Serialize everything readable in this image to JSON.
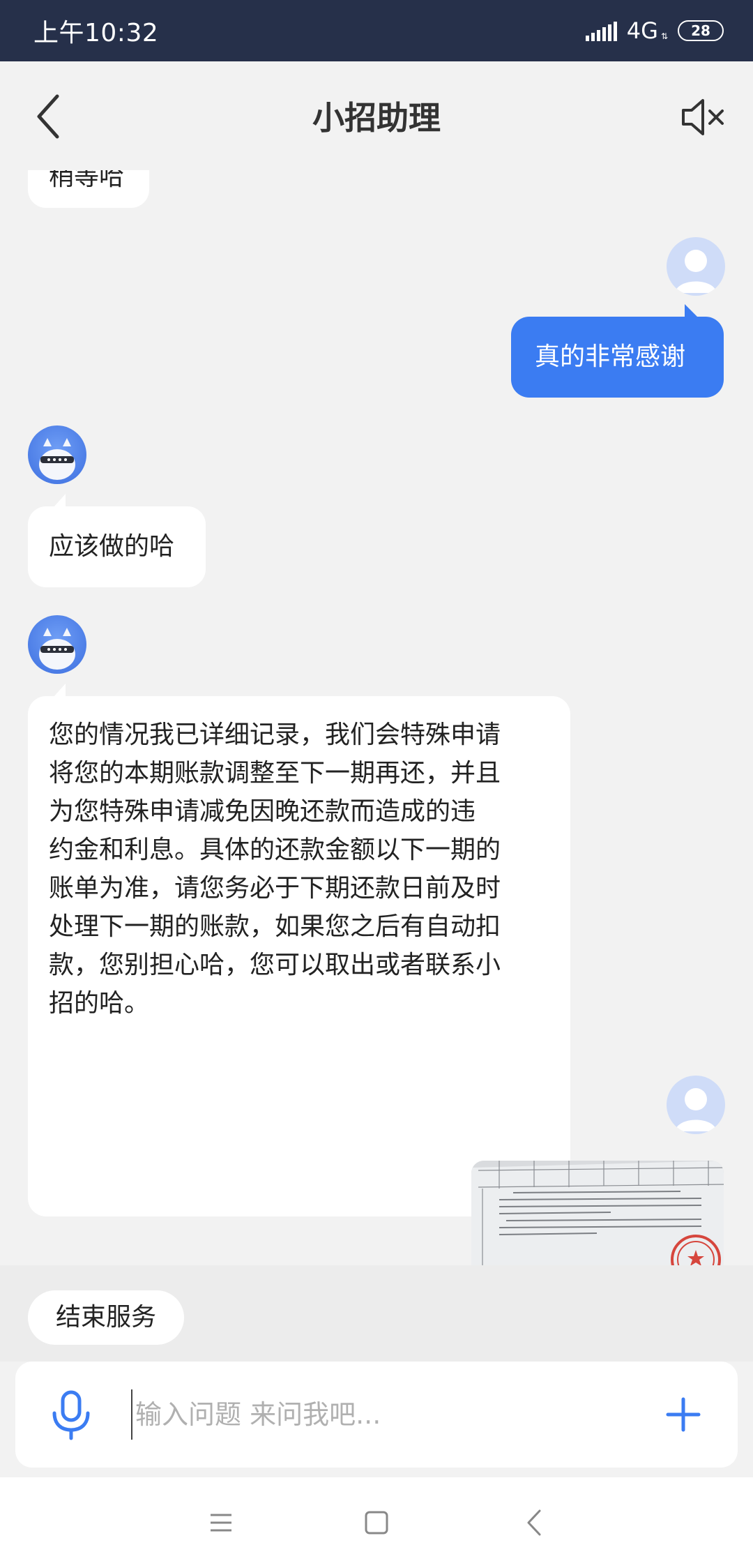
{
  "status_bar": {
    "time": "上午10:32",
    "network": "4G",
    "battery": "28"
  },
  "header": {
    "title": "小招助理"
  },
  "messages": {
    "partial_top": "稍等哈",
    "user_1": "真的非常感谢",
    "bot_1": "应该做的哈",
    "bot_2_lines": [
      "您的情况我已详细记录，我们会特殊申请",
      "将您的本期账款调整至下一期再还，并且",
      "为您特殊申请减免因晚还款而造成的违",
      "约金和利息。具体的还款金额以下一期的",
      "账单为准，请您务必于下期还款日前及时",
      "处理下一期的账款，如果您之后有自动扣",
      "款，您别担心哈，您可以取出或者联系小",
      "招的哈。"
    ]
  },
  "quick_actions": {
    "end_service": "结束服务"
  },
  "input": {
    "placeholder": "输入问题 来问我吧..."
  },
  "icons": {
    "back": "chevron-left-icon",
    "mute": "speaker-muted-icon",
    "mic": "microphone-icon",
    "plus": "plus-icon"
  },
  "colors": {
    "accent": "#3b7cf2",
    "status_bar": "#26304a"
  }
}
